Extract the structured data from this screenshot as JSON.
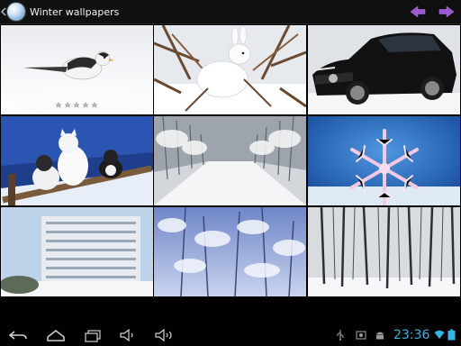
{
  "app": {
    "title": "Winter wallpapers",
    "icon": "snowball-app-icon",
    "accent_color": "#9b59d0"
  },
  "actions": {
    "previous": "arrow-left-icon",
    "next": "arrow-right-icon"
  },
  "wallpapers": [
    {
      "subject": "bird on snow"
    },
    {
      "subject": "white rabbit in snow"
    },
    {
      "subject": "black car in snow"
    },
    {
      "subject": "cats on snowy bench"
    },
    {
      "subject": "snowy forest road"
    },
    {
      "subject": "snowflake on blue"
    },
    {
      "subject": "snowy apartment building"
    },
    {
      "subject": "frosted trees"
    },
    {
      "subject": "snowy birch forest"
    }
  ],
  "rating": {
    "stars": 5,
    "filled": 0
  },
  "system_bar": {
    "clock": "23:36",
    "clock_color": "#33b5e5",
    "buttons": [
      "back-icon",
      "home-icon",
      "recent-apps-icon",
      "volume-down-icon",
      "volume-up-icon"
    ],
    "status_icons": [
      "usb-icon",
      "screenshot-icon",
      "android-icon",
      "wifi-icon",
      "battery-icon"
    ]
  }
}
